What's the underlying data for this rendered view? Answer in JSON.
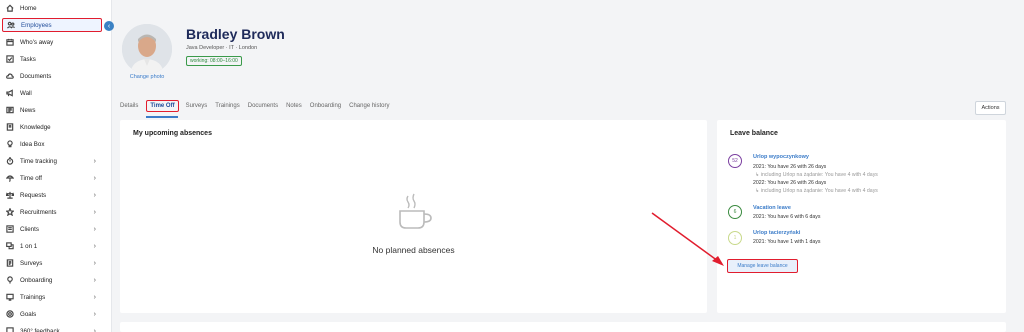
{
  "sidebar": {
    "items": [
      {
        "label": "Home",
        "icon": "home-icon",
        "chevron": false
      },
      {
        "label": "Employees",
        "icon": "users-icon",
        "chevron": false,
        "active": true
      },
      {
        "label": "Who's away",
        "icon": "calendar-icon",
        "chevron": false
      },
      {
        "label": "Tasks",
        "icon": "tasks-icon",
        "chevron": false
      },
      {
        "label": "Documents",
        "icon": "cloud-icon",
        "chevron": false
      },
      {
        "label": "Wall",
        "icon": "megaphone-icon",
        "chevron": false
      },
      {
        "label": "News",
        "icon": "news-icon",
        "chevron": false
      },
      {
        "label": "Knowledge",
        "icon": "book-icon",
        "chevron": false
      },
      {
        "label": "Idea Box",
        "icon": "lightbulb-icon",
        "chevron": false
      },
      {
        "label": "Time tracking",
        "icon": "stopwatch-icon",
        "chevron": true
      },
      {
        "label": "Time off",
        "icon": "umbrella-icon",
        "chevron": true
      },
      {
        "label": "Requests",
        "icon": "scale-icon",
        "chevron": true
      },
      {
        "label": "Recruitments",
        "icon": "star-icon",
        "chevron": true
      },
      {
        "label": "Clients",
        "icon": "clients-icon",
        "chevron": true
      },
      {
        "label": "1 on 1",
        "icon": "chat-icon",
        "chevron": true
      },
      {
        "label": "Surveys",
        "icon": "survey-icon",
        "chevron": true
      },
      {
        "label": "Onboarding",
        "icon": "pin-icon",
        "chevron": true
      },
      {
        "label": "Trainings",
        "icon": "training-icon",
        "chevron": true
      },
      {
        "label": "Goals",
        "icon": "target-icon",
        "chevron": true
      },
      {
        "label": "360° feedback",
        "icon": "feedback-icon",
        "chevron": true
      }
    ],
    "collapse_icon": "chevron-left-icon"
  },
  "employee": {
    "name": "Bradley Brown",
    "subtitle": "Java Developer · IT · London",
    "work_hours": "working: 08:00–16:00",
    "change_photo": "Change photo"
  },
  "tabs": [
    "Details",
    "Time Off",
    "Surveys",
    "Trainings",
    "Documents",
    "Notes",
    "Onboarding",
    "Change history"
  ],
  "active_tab": "Time Off",
  "actions_label": "Actions",
  "absences": {
    "title": "My upcoming absences",
    "empty_text": "No planned absences"
  },
  "leave_balance": {
    "title": "Leave balance",
    "items": [
      {
        "badge": "52",
        "color": "#7b3fa0",
        "title": "Urlop wypoczynkowy",
        "lines": [
          {
            "text": "2021: You have 26 with 26 days",
            "muted": false
          },
          {
            "text": "↳ including Urlop na żądanie: You have 4 with 4 days",
            "muted": true
          },
          {
            "text": "2022: You have 26 with 26 days",
            "muted": false
          },
          {
            "text": "↳ including Urlop na żądanie: You have 4 with 4 days",
            "muted": true
          }
        ]
      },
      {
        "badge": "6",
        "color": "#3a8a3f",
        "title": "Vacation leave",
        "lines": [
          {
            "text": "2021: You have 6 with 6 days",
            "muted": false
          }
        ]
      },
      {
        "badge": "1",
        "color": "#c8d98a",
        "title": "Urlop tacierzyński",
        "lines": [
          {
            "text": "2021: You have 1 with 1 days",
            "muted": false
          }
        ]
      }
    ],
    "manage_label": "Manage leave balance"
  },
  "colors": {
    "accent": "#3a7bc8",
    "highlight": "#e11d2e",
    "name": "#1e2a5a"
  }
}
